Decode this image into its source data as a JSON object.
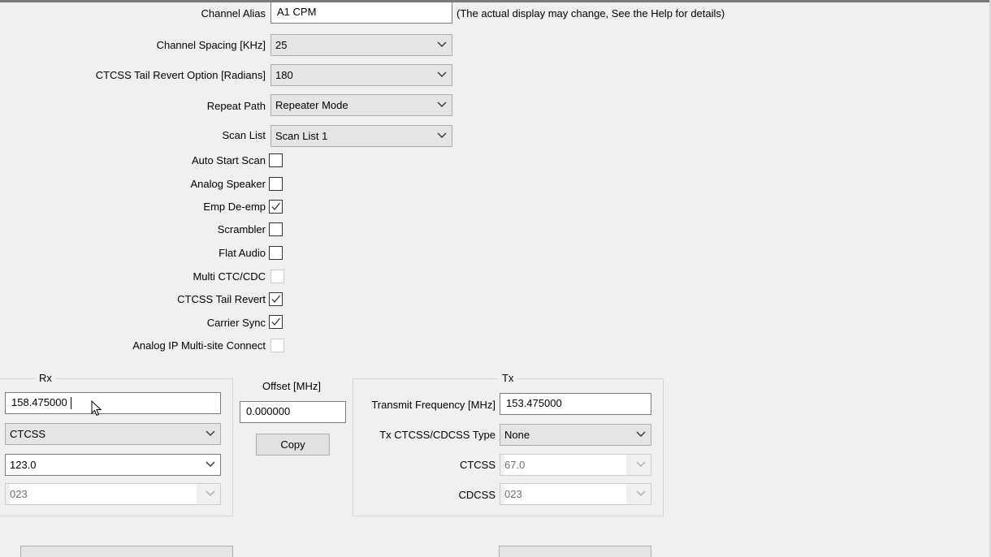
{
  "channel_alias": {
    "label": "Channel Alias",
    "value": "A1 CPM",
    "note": "(The actual display may change, See the Help for details)"
  },
  "channel_spacing": {
    "label": "Channel Spacing [KHz]",
    "value": "25"
  },
  "ctcss_tail_revert_option": {
    "label": "CTCSS Tail Revert Option [Radians]",
    "value": "180"
  },
  "repeat_path": {
    "label": "Repeat Path",
    "value": "Repeater Mode"
  },
  "scan_list": {
    "label": "Scan List",
    "value": "Scan List 1"
  },
  "checkboxes": [
    {
      "label": "Auto Start Scan",
      "checked": false,
      "enabled": true
    },
    {
      "label": "Analog Speaker",
      "checked": false,
      "enabled": true
    },
    {
      "label": "Emp De-emp",
      "checked": true,
      "enabled": true
    },
    {
      "label": "Scrambler",
      "checked": false,
      "enabled": true
    },
    {
      "label": "Flat Audio",
      "checked": false,
      "enabled": true
    },
    {
      "label": "Multi CTC/CDC",
      "checked": false,
      "enabled": false
    },
    {
      "label": "CTCSS Tail Revert",
      "checked": true,
      "enabled": true
    },
    {
      "label": "Carrier Sync",
      "checked": true,
      "enabled": true
    },
    {
      "label": "Analog IP Multi-site Connect",
      "checked": false,
      "enabled": false
    }
  ],
  "rx": {
    "title": "Rx",
    "frequency": "158.475000",
    "type": "CTCSS",
    "ctcss": "123.0",
    "cdcss": "023"
  },
  "offset": {
    "label": "Offset [MHz]",
    "value": "0.000000",
    "copy_label": "Copy"
  },
  "tx": {
    "title": "Tx",
    "frequency_label": "Transmit Frequency [MHz]",
    "frequency": "153.475000",
    "type_label": "Tx CTCSS/CDCSS Type",
    "type": "None",
    "ctcss_label": "CTCSS",
    "ctcss": "67.0",
    "cdcss_label": "CDCSS",
    "cdcss": "023"
  }
}
